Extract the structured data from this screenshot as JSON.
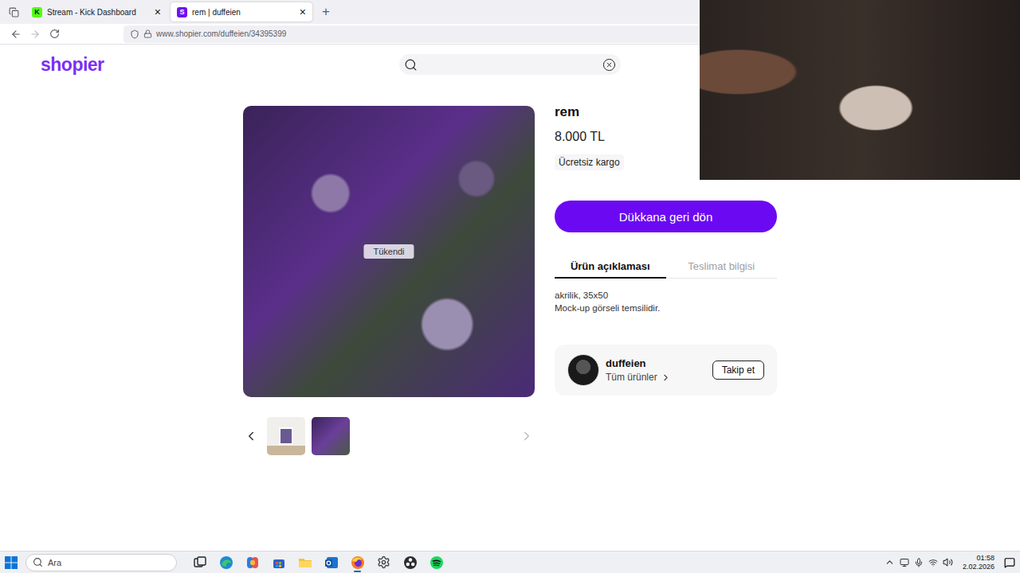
{
  "browser": {
    "tabs": [
      {
        "label": "Stream - Kick Dashboard",
        "favicon": "K",
        "color": "#53fc18",
        "close": "×",
        "selected": false
      },
      {
        "label": "rem | duffeien",
        "favicon": "S",
        "color": "#6f12f0",
        "close": "×",
        "selected": true
      }
    ],
    "new_tab": "+",
    "url": "www.shopier.com/duffeien/34395399"
  },
  "site": {
    "logo": "shopier"
  },
  "product": {
    "title": "rem",
    "price": "8.000 TL",
    "shipping": "Ücretsiz kargo",
    "badge": "Tükendi",
    "back_button": "Dükkana geri dön",
    "tabs": [
      {
        "label": "Ürün açıklaması",
        "selected": true
      },
      {
        "label": "Teslimat bilgisi",
        "selected": false
      }
    ],
    "description": [
      "akrilik, 35x50",
      "Mock-up görseli temsilidir."
    ],
    "thumbnails": [
      {
        "kind": "mockup"
      },
      {
        "kind": "painting"
      }
    ]
  },
  "seller": {
    "name": "duffeien",
    "link": "Tüm ürünler",
    "follow_button": "Takip et"
  },
  "taskbar": {
    "search": {
      "placeholder": "Ara"
    },
    "apps": [
      {
        "kind": "task-view",
        "active": false
      },
      {
        "kind": "edge",
        "active": false
      },
      {
        "kind": "copilot",
        "active": false
      },
      {
        "kind": "store",
        "active": false
      },
      {
        "kind": "explorer",
        "active": false
      },
      {
        "kind": "outlook",
        "active": false
      },
      {
        "kind": "firefox",
        "active": true
      },
      {
        "kind": "settings",
        "active": false
      },
      {
        "kind": "obs",
        "active": false
      },
      {
        "kind": "spotify",
        "active": false
      }
    ],
    "clock": {
      "time": "01:58",
      "date": "2.02.2026"
    }
  }
}
